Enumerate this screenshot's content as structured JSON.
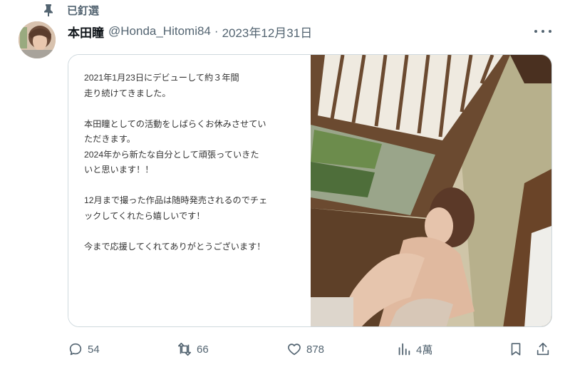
{
  "pinned": {
    "label": "已釘選",
    "icon": "pin-icon"
  },
  "author": {
    "name": "本田瞳",
    "handle": "@Honda_Hitomi84",
    "separator": "·",
    "date": "2023年12月31日"
  },
  "post_image": {
    "paragraphs": [
      "2021年1月23日にデビューして約３年間\n走り続けてきました。",
      "本田瞳としての活動をしばらくお休みさせてい\nただきます。\n2024年から新たな自分として頑張っていきた\nいと思います！！",
      "12月まで撮った作品は随時発売されるのでチェ\nックしてくれたら嬉しいです！",
      "今まで応援してくれてありがとうございます！"
    ]
  },
  "actions": {
    "replies": "54",
    "retweets": "66",
    "likes": "878",
    "views": "4萬"
  },
  "colors": {
    "secondary_text": "#536471",
    "border": "#cfd9de",
    "primary_text": "#0f1419"
  }
}
